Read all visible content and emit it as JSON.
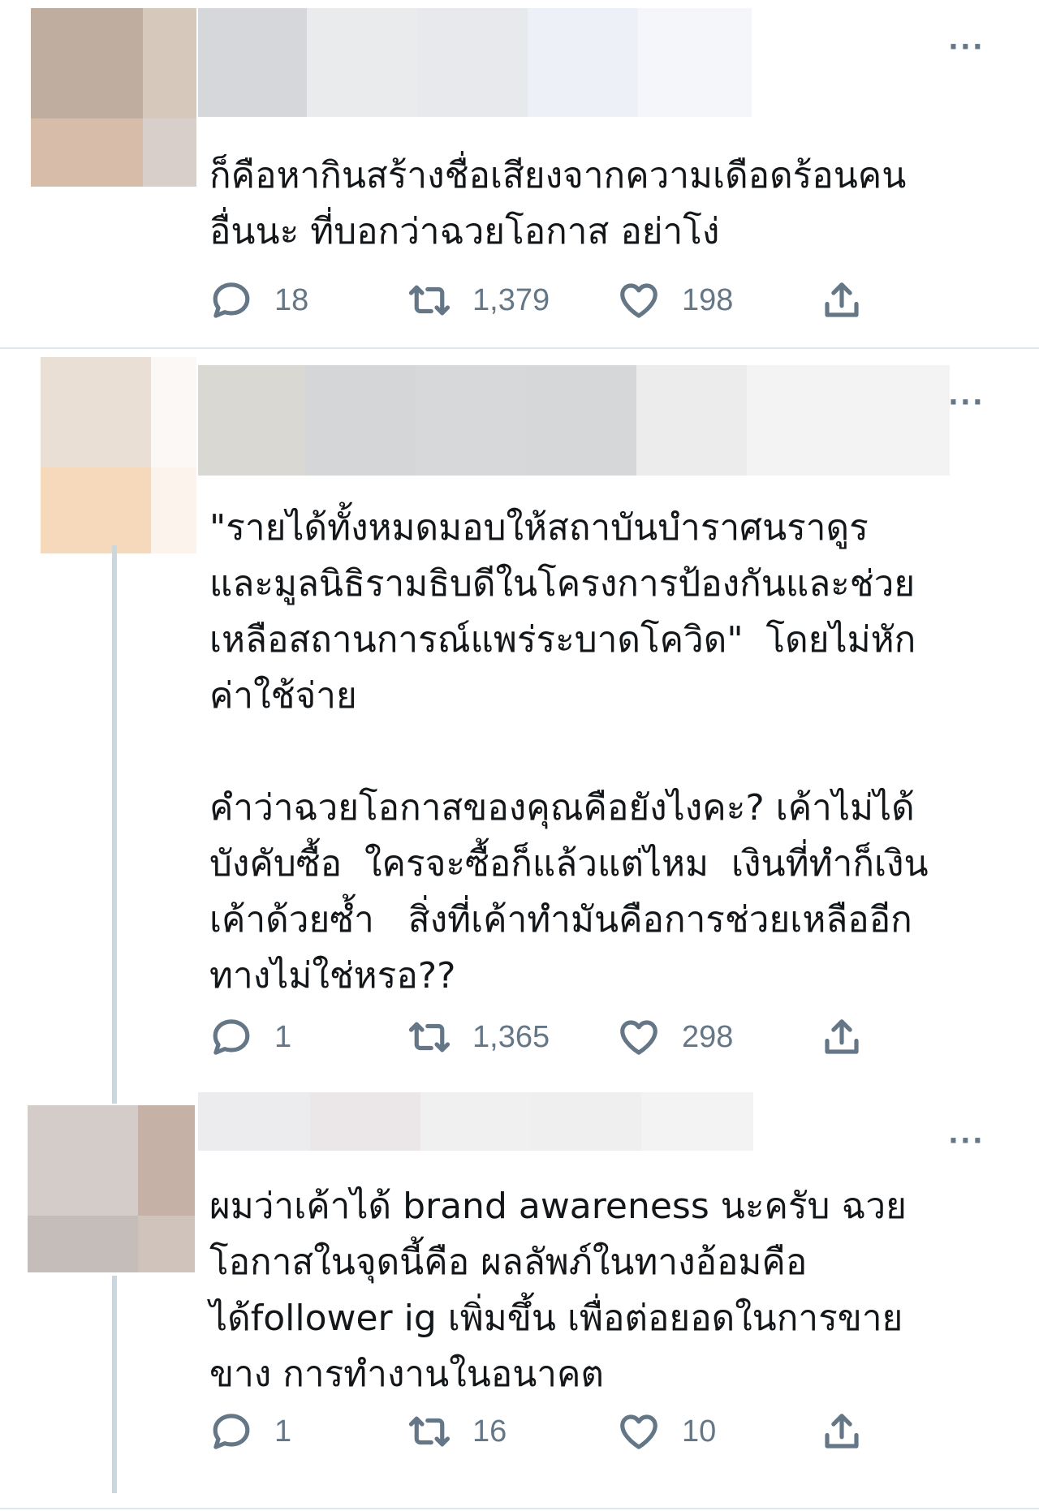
{
  "tweets": [
    {
      "text": "ก็คือหากินสร้างชื่อเสียงจากความเดือดร้อนคน\nอื่นนะ ที่บอกว่าฉวยโอกาส อย่าโง่",
      "replies": "18",
      "retweets": "1,379",
      "likes": "198",
      "more_label": "···",
      "avatar_colors": [
        "#bfaea0",
        "#d7c8bc",
        "#d6bca9",
        "#d8cfca"
      ],
      "name_colors": [
        "#d6d7db",
        "#eaebed",
        "#e8e9ec",
        "#edf0f6",
        "#f4f6fa"
      ]
    },
    {
      "text": "\"รายได้ทั้งหมดมอบให้สถาบันบำราศนราดูร\nและมูลนิธิรามธิบดีในโครงการป้องกันและช่วย\nเหลือสถานการณ์แพร่ระบาดโควิด\"  โดยไม่หัก\nค่าใช้จ่าย\n\nคำว่าฉวยโอกาสของคุณคือยังไงคะ? เค้าไม่ได้\nบังคับซื้อ  ใครจะซื้อก็แล้วแต่ไหม  เงินที่ทำก็เงิน\nเค้าด้วยซ้ำ   สิ่งที่เค้าทำมันคือการช่วยเหลืออีก\nทางไม่ใช่หรอ??",
      "replies": "1",
      "retweets": "1,365",
      "likes": "298",
      "more_label": "···",
      "avatar_colors": [
        "#eadfd4",
        "#fcf8f5",
        "#f6d8bb",
        "#fdf3ed"
      ],
      "name_colors": [
        "#d9d8d3",
        "#d5d6d8",
        "#d7d8da",
        "#d6d7d9",
        "#ececed",
        "#f3f3f4"
      ]
    },
    {
      "text": "ผมว่าเค้าได้ brand awareness นะครับ ฉวย\nโอกาสในจุดนี้คือ ผลลัพภ์ในทางอ้อมคือ\nได้follower ig เพิ่มขึ้น เพื่อต่อยอดในการขาย\nขาง การทำงานในอนาคต",
      "replies": "1",
      "retweets": "16",
      "likes": "10",
      "more_label": "···",
      "avatar_colors": [
        "#d3ccc9",
        "#c5b1a5",
        "#c4bdb9",
        "#cfc3bc"
      ],
      "name_colors": [
        "#ececee",
        "#ebe7e8",
        "#f0f0f1",
        "#efeff0",
        "#f3f3f4"
      ]
    }
  ],
  "icons": {
    "reply": "reply-icon",
    "retweet": "retweet-icon",
    "like": "heart-icon",
    "share": "share-icon"
  },
  "colors": {
    "text": "#14171a",
    "muted": "#657786",
    "divider": "#e1e8ed",
    "thread_line": "#ccd6dd"
  }
}
